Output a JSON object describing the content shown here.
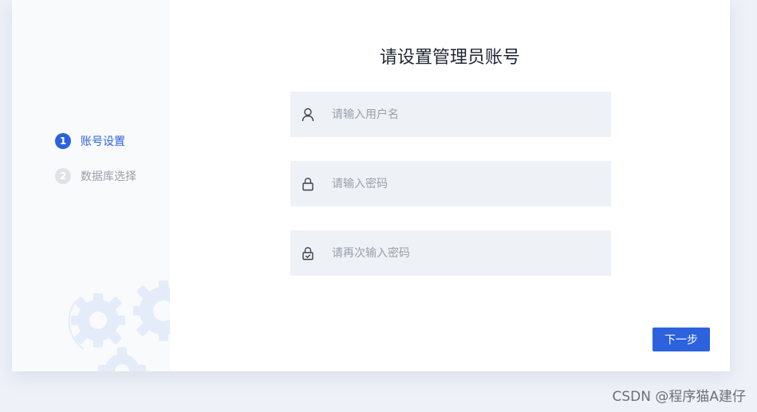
{
  "steps": [
    {
      "number": "1",
      "label": "账号设置",
      "active": true
    },
    {
      "number": "2",
      "label": "数据库选择",
      "active": false
    }
  ],
  "main": {
    "title": "请设置管理员账号",
    "fields": {
      "username": {
        "placeholder": "请输入用户名",
        "value": ""
      },
      "password": {
        "placeholder": "请输入密码",
        "value": ""
      },
      "confirm": {
        "placeholder": "请再次输入密码",
        "value": ""
      }
    },
    "next_label": "下一步"
  },
  "watermark": "CSDN @程序猫A建仔",
  "colors": {
    "accent": "#2c62de",
    "field_bg": "#eef1f6",
    "gear": "#e4ecf9"
  },
  "icons": [
    "user-icon",
    "lock-icon",
    "lock-check-icon",
    "gear-icon"
  ]
}
